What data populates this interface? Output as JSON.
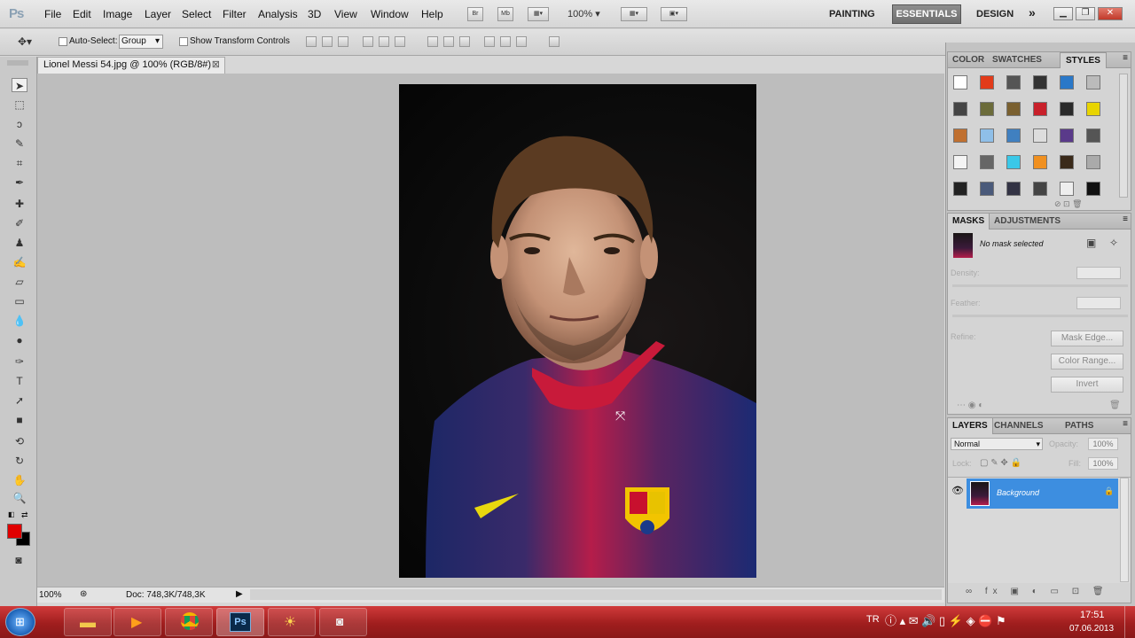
{
  "menubar": {
    "logo": "Ps",
    "menus": [
      "File",
      "Edit",
      "Image",
      "Layer",
      "Select",
      "Filter",
      "Analysis",
      "3D",
      "View",
      "Window",
      "Help"
    ],
    "bridge_label": "Br",
    "mini_bridge_label": "Mb",
    "zoom": "100%",
    "workspaces": {
      "painting": "PAINTING",
      "essentials": "ESSENTIALS",
      "design": "DESIGN",
      "more": "»"
    }
  },
  "options": {
    "auto_select_label": "Auto-Select:",
    "auto_select_value": "Group",
    "transform_label": "Show Transform Controls"
  },
  "document": {
    "tab_title": "Lionel Messi 54.jpg @ 100% (RGB/8#)",
    "status_zoom": "100%",
    "doc_info": "Doc: 748,3K/748,3K"
  },
  "panel_styles": {
    "tabs": [
      "COLOR",
      "SWATCHES",
      "STYLES"
    ],
    "active_tab": "STYLES"
  },
  "panel_masks": {
    "tabs": [
      "MASKS",
      "ADJUSTMENTS"
    ],
    "status": "No mask selected",
    "density_label": "Density:",
    "feather_label": "Feather:",
    "refine_label": "Refine:",
    "mask_edge_button": "Mask Edge...",
    "color_range_button": "Color Range...",
    "invert_button": "Invert"
  },
  "panel_layers": {
    "tabs": [
      "LAYERS",
      "CHANNELS",
      "PATHS"
    ],
    "blend_mode": "Normal",
    "opacity_label": "Opacity:",
    "opacity_value": "100%",
    "lock_label": "Lock:",
    "fill_label": "Fill:",
    "fill_value": "100%",
    "layer_name": "Background"
  },
  "taskbar": {
    "language": "TR",
    "time": "17:51",
    "date": "07.06.2013"
  },
  "colors": {
    "foreground": "#e00000",
    "background": "#000000",
    "selected_layer": "#3d8ee0",
    "taskbar": "#b02424"
  }
}
